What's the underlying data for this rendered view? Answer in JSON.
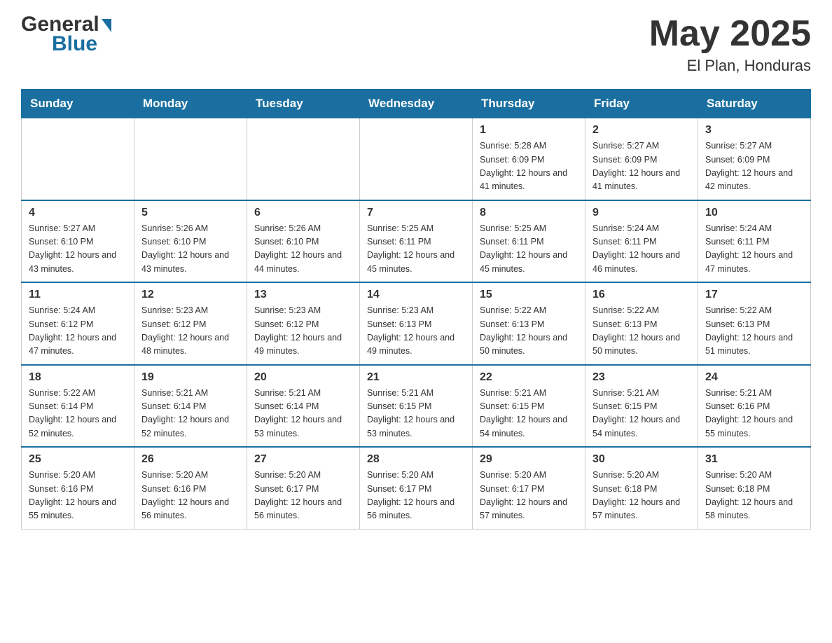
{
  "header": {
    "logo": {
      "general": "General",
      "blue": "Blue",
      "arrow": "▶"
    },
    "title": "May 2025",
    "location": "El Plan, Honduras"
  },
  "weekdays": [
    "Sunday",
    "Monday",
    "Tuesday",
    "Wednesday",
    "Thursday",
    "Friday",
    "Saturday"
  ],
  "weeks": [
    [
      {
        "day": "",
        "sunrise": "",
        "sunset": "",
        "daylight": ""
      },
      {
        "day": "",
        "sunrise": "",
        "sunset": "",
        "daylight": ""
      },
      {
        "day": "",
        "sunrise": "",
        "sunset": "",
        "daylight": ""
      },
      {
        "day": "",
        "sunrise": "",
        "sunset": "",
        "daylight": ""
      },
      {
        "day": "1",
        "sunrise": "Sunrise: 5:28 AM",
        "sunset": "Sunset: 6:09 PM",
        "daylight": "Daylight: 12 hours and 41 minutes."
      },
      {
        "day": "2",
        "sunrise": "Sunrise: 5:27 AM",
        "sunset": "Sunset: 6:09 PM",
        "daylight": "Daylight: 12 hours and 41 minutes."
      },
      {
        "day": "3",
        "sunrise": "Sunrise: 5:27 AM",
        "sunset": "Sunset: 6:09 PM",
        "daylight": "Daylight: 12 hours and 42 minutes."
      }
    ],
    [
      {
        "day": "4",
        "sunrise": "Sunrise: 5:27 AM",
        "sunset": "Sunset: 6:10 PM",
        "daylight": "Daylight: 12 hours and 43 minutes."
      },
      {
        "day": "5",
        "sunrise": "Sunrise: 5:26 AM",
        "sunset": "Sunset: 6:10 PM",
        "daylight": "Daylight: 12 hours and 43 minutes."
      },
      {
        "day": "6",
        "sunrise": "Sunrise: 5:26 AM",
        "sunset": "Sunset: 6:10 PM",
        "daylight": "Daylight: 12 hours and 44 minutes."
      },
      {
        "day": "7",
        "sunrise": "Sunrise: 5:25 AM",
        "sunset": "Sunset: 6:11 PM",
        "daylight": "Daylight: 12 hours and 45 minutes."
      },
      {
        "day": "8",
        "sunrise": "Sunrise: 5:25 AM",
        "sunset": "Sunset: 6:11 PM",
        "daylight": "Daylight: 12 hours and 45 minutes."
      },
      {
        "day": "9",
        "sunrise": "Sunrise: 5:24 AM",
        "sunset": "Sunset: 6:11 PM",
        "daylight": "Daylight: 12 hours and 46 minutes."
      },
      {
        "day": "10",
        "sunrise": "Sunrise: 5:24 AM",
        "sunset": "Sunset: 6:11 PM",
        "daylight": "Daylight: 12 hours and 47 minutes."
      }
    ],
    [
      {
        "day": "11",
        "sunrise": "Sunrise: 5:24 AM",
        "sunset": "Sunset: 6:12 PM",
        "daylight": "Daylight: 12 hours and 47 minutes."
      },
      {
        "day": "12",
        "sunrise": "Sunrise: 5:23 AM",
        "sunset": "Sunset: 6:12 PM",
        "daylight": "Daylight: 12 hours and 48 minutes."
      },
      {
        "day": "13",
        "sunrise": "Sunrise: 5:23 AM",
        "sunset": "Sunset: 6:12 PM",
        "daylight": "Daylight: 12 hours and 49 minutes."
      },
      {
        "day": "14",
        "sunrise": "Sunrise: 5:23 AM",
        "sunset": "Sunset: 6:13 PM",
        "daylight": "Daylight: 12 hours and 49 minutes."
      },
      {
        "day": "15",
        "sunrise": "Sunrise: 5:22 AM",
        "sunset": "Sunset: 6:13 PM",
        "daylight": "Daylight: 12 hours and 50 minutes."
      },
      {
        "day": "16",
        "sunrise": "Sunrise: 5:22 AM",
        "sunset": "Sunset: 6:13 PM",
        "daylight": "Daylight: 12 hours and 50 minutes."
      },
      {
        "day": "17",
        "sunrise": "Sunrise: 5:22 AM",
        "sunset": "Sunset: 6:13 PM",
        "daylight": "Daylight: 12 hours and 51 minutes."
      }
    ],
    [
      {
        "day": "18",
        "sunrise": "Sunrise: 5:22 AM",
        "sunset": "Sunset: 6:14 PM",
        "daylight": "Daylight: 12 hours and 52 minutes."
      },
      {
        "day": "19",
        "sunrise": "Sunrise: 5:21 AM",
        "sunset": "Sunset: 6:14 PM",
        "daylight": "Daylight: 12 hours and 52 minutes."
      },
      {
        "day": "20",
        "sunrise": "Sunrise: 5:21 AM",
        "sunset": "Sunset: 6:14 PM",
        "daylight": "Daylight: 12 hours and 53 minutes."
      },
      {
        "day": "21",
        "sunrise": "Sunrise: 5:21 AM",
        "sunset": "Sunset: 6:15 PM",
        "daylight": "Daylight: 12 hours and 53 minutes."
      },
      {
        "day": "22",
        "sunrise": "Sunrise: 5:21 AM",
        "sunset": "Sunset: 6:15 PM",
        "daylight": "Daylight: 12 hours and 54 minutes."
      },
      {
        "day": "23",
        "sunrise": "Sunrise: 5:21 AM",
        "sunset": "Sunset: 6:15 PM",
        "daylight": "Daylight: 12 hours and 54 minutes."
      },
      {
        "day": "24",
        "sunrise": "Sunrise: 5:21 AM",
        "sunset": "Sunset: 6:16 PM",
        "daylight": "Daylight: 12 hours and 55 minutes."
      }
    ],
    [
      {
        "day": "25",
        "sunrise": "Sunrise: 5:20 AM",
        "sunset": "Sunset: 6:16 PM",
        "daylight": "Daylight: 12 hours and 55 minutes."
      },
      {
        "day": "26",
        "sunrise": "Sunrise: 5:20 AM",
        "sunset": "Sunset: 6:16 PM",
        "daylight": "Daylight: 12 hours and 56 minutes."
      },
      {
        "day": "27",
        "sunrise": "Sunrise: 5:20 AM",
        "sunset": "Sunset: 6:17 PM",
        "daylight": "Daylight: 12 hours and 56 minutes."
      },
      {
        "day": "28",
        "sunrise": "Sunrise: 5:20 AM",
        "sunset": "Sunset: 6:17 PM",
        "daylight": "Daylight: 12 hours and 56 minutes."
      },
      {
        "day": "29",
        "sunrise": "Sunrise: 5:20 AM",
        "sunset": "Sunset: 6:17 PM",
        "daylight": "Daylight: 12 hours and 57 minutes."
      },
      {
        "day": "30",
        "sunrise": "Sunrise: 5:20 AM",
        "sunset": "Sunset: 6:18 PM",
        "daylight": "Daylight: 12 hours and 57 minutes."
      },
      {
        "day": "31",
        "sunrise": "Sunrise: 5:20 AM",
        "sunset": "Sunset: 6:18 PM",
        "daylight": "Daylight: 12 hours and 58 minutes."
      }
    ]
  ]
}
